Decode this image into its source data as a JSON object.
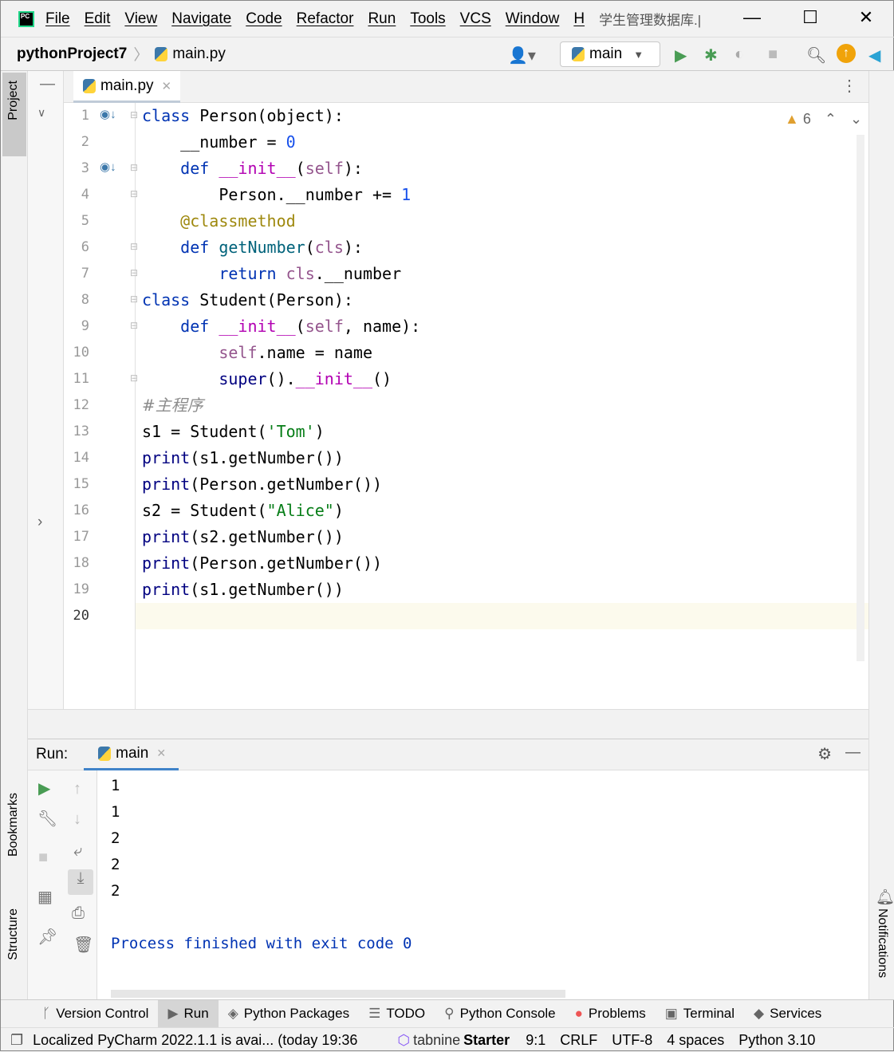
{
  "title": {
    "menu": [
      "File",
      "Edit",
      "View",
      "Navigate",
      "Code",
      "Refactor",
      "Run",
      "Tools",
      "VCS",
      "Window",
      "H"
    ],
    "window_title": "学生管理数据库.|"
  },
  "nav": {
    "project": "pythonProject7",
    "file": "main.py",
    "run_config": "main"
  },
  "editor": {
    "tab": "main.py",
    "warnings": "6",
    "lines": [
      [
        [
          "class ",
          "kw"
        ],
        [
          "Person(object):",
          ""
        ]
      ],
      [
        [
          "    __number = ",
          ""
        ],
        [
          "0",
          "num"
        ]
      ],
      [
        [
          "    def ",
          "kw"
        ],
        [
          "__init__",
          "dun"
        ],
        [
          "(",
          ""
        ],
        [
          "self",
          "self"
        ],
        [
          "):",
          ""
        ]
      ],
      [
        [
          "        Person.__number += ",
          ""
        ],
        [
          "1",
          "num"
        ]
      ],
      [
        [
          "    ",
          ""
        ],
        [
          "@classmethod",
          "dec"
        ]
      ],
      [
        [
          "    def ",
          "kw"
        ],
        [
          "getNumber",
          "fn"
        ],
        [
          "(",
          ""
        ],
        [
          "cls",
          "self"
        ],
        [
          "):",
          ""
        ]
      ],
      [
        [
          "        return ",
          "kw"
        ],
        [
          "cls",
          "self"
        ],
        [
          ".__number",
          ""
        ]
      ],
      [
        [
          "class ",
          "kw"
        ],
        [
          "Student(Person):",
          ""
        ]
      ],
      [
        [
          "    def ",
          "kw"
        ],
        [
          "__init__",
          "dun"
        ],
        [
          "(",
          ""
        ],
        [
          "self",
          "self"
        ],
        [
          ", name):",
          ""
        ]
      ],
      [
        [
          "        ",
          ""
        ],
        [
          "self",
          "self"
        ],
        [
          ".name = name",
          ""
        ]
      ],
      [
        [
          "        ",
          ""
        ],
        [
          "super",
          "bi"
        ],
        [
          "().",
          ""
        ],
        [
          "__init__",
          "dun"
        ],
        [
          "()",
          ""
        ]
      ],
      [
        [
          "#主程序",
          "cm"
        ]
      ],
      [
        [
          "s1 = Student(",
          ""
        ],
        [
          "'Tom'",
          "str"
        ],
        [
          ")",
          ""
        ]
      ],
      [
        [
          "print",
          "bi"
        ],
        [
          "(s1.getNumber())",
          ""
        ]
      ],
      [
        [
          "print",
          "bi"
        ],
        [
          "(Person.getNumber())",
          ""
        ]
      ],
      [
        [
          "s2 = Student(",
          ""
        ],
        [
          "\"Alice\"",
          "str"
        ],
        [
          ")",
          ""
        ]
      ],
      [
        [
          "print",
          "bi"
        ],
        [
          "(s2.getNumber())",
          ""
        ]
      ],
      [
        [
          "print",
          "bi"
        ],
        [
          "(Person.getNumber())",
          ""
        ]
      ],
      [
        [
          "print",
          "bi"
        ],
        [
          "(s1.getNumber())",
          ""
        ]
      ],
      []
    ]
  },
  "run": {
    "label": "Run:",
    "tab": "main",
    "output": [
      "1",
      "1",
      "2",
      "2",
      "2",
      "",
      "Process finished with exit code 0"
    ]
  },
  "sidebars": {
    "project": "Project",
    "bookmarks": "Bookmarks",
    "structure": "Structure",
    "notifications": "Notifications"
  },
  "toolwindows": [
    "Version Control",
    "Run",
    "Python Packages",
    "TODO",
    "Python Console",
    "Problems",
    "Terminal",
    "Services"
  ],
  "status": {
    "message": "Localized PyCharm 2022.1.1 is avai... (today 19:36",
    "tabnine": "tabnine",
    "tabnine_plan": "Starter",
    "position": "9:1",
    "line_sep": "CRLF",
    "encoding": "UTF-8",
    "indent": "4 spaces",
    "interpreter": "Python 3.10"
  },
  "colors": {
    "keyword": "#0033b3",
    "string": "#067d17",
    "number": "#1750eb",
    "run_green": "#499c54"
  }
}
